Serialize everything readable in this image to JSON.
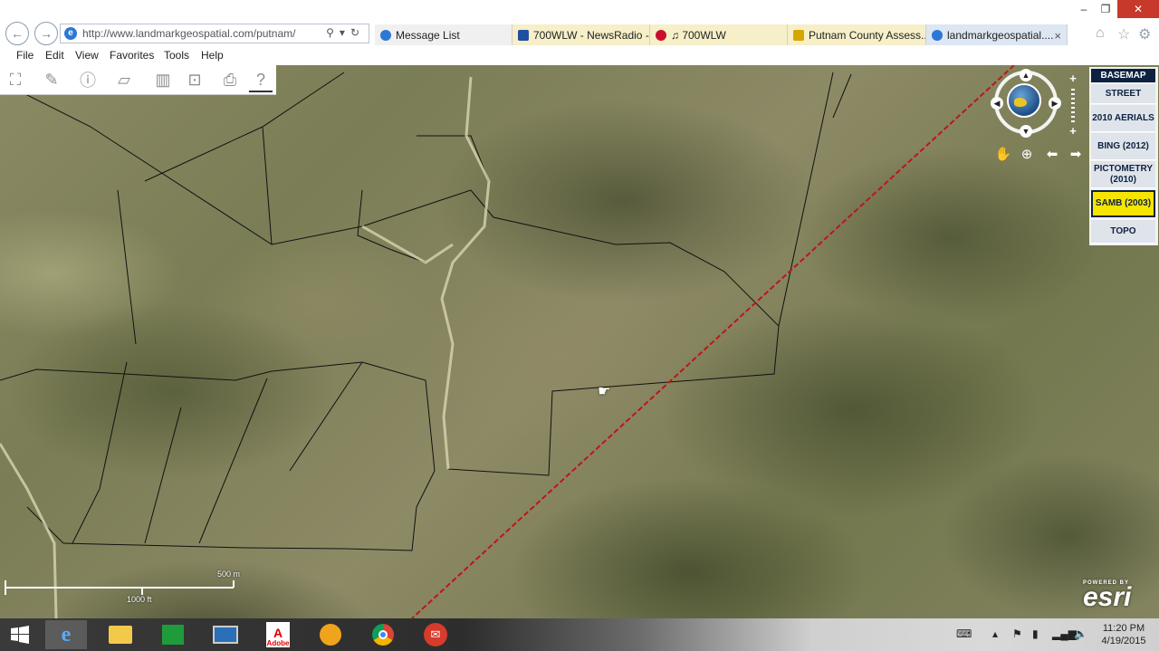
{
  "browser": {
    "url": "http://www.landmarkgeospatial.com/putnam/",
    "tabs": [
      {
        "label": "Message List",
        "icon": "ie-page-icon",
        "color": "#2b78d6"
      },
      {
        "label": "700WLW - NewsRadio -...",
        "icon": "station-icon",
        "color": "#1f4fa3"
      },
      {
        "label": "♫ 700WLW",
        "icon": "iheart-icon",
        "color": "#c8102e"
      },
      {
        "label": "Putnam County Assess...",
        "icon": "bookmark-icon",
        "color": "#d6a600"
      },
      {
        "label": "landmarkgeospatial....",
        "icon": "ie-page-icon",
        "color": "#2b78d6"
      }
    ],
    "tab_close": "×",
    "window_controls": {
      "minimize": "–",
      "restore": "❐",
      "close": "✕"
    },
    "menu": [
      "File",
      "Edit",
      "View",
      "Favorites",
      "Tools",
      "Help"
    ]
  },
  "map": {
    "tools": [
      "layers-tool",
      "measure-tool",
      "info-tool",
      "draw-tool",
      "parcel-tool",
      "legend-tool",
      "print-tool",
      "help-tool"
    ],
    "basemap": {
      "title": "BASEMAP",
      "options": [
        "STREET",
        "2010 AERIALS",
        "BING (2012)",
        "PICTOMETRY (2010)",
        "SAMB (2003)",
        "TOPO"
      ],
      "selected": "SAMB (2003)"
    },
    "scale": {
      "metric": "500 m",
      "imperial": "1000 ft"
    },
    "attribution": {
      "powered_by": "POWERED BY",
      "logo": "esri"
    }
  },
  "taskbar": {
    "apps": [
      "windows-start",
      "internet-explorer",
      "file-explorer",
      "store",
      "remote-desktop",
      "adobe",
      "audio-player",
      "chrome",
      "mail"
    ],
    "adobe_label": "Adobe",
    "time": "11:20 PM",
    "date": "4/19/2015"
  }
}
